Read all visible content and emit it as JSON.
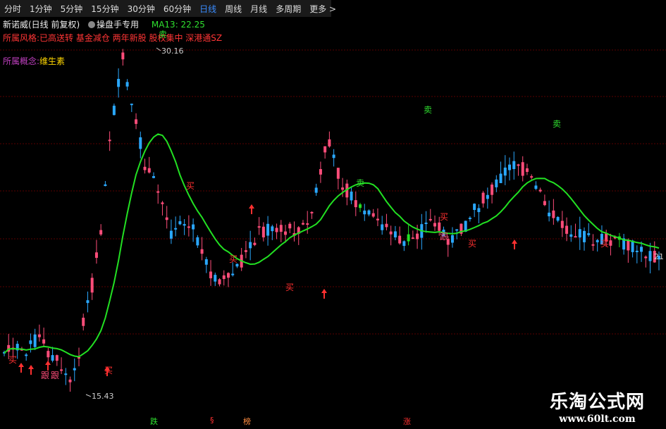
{
  "toolbar": {
    "tabs": [
      "分时",
      "1分钟",
      "5分钟",
      "15分钟",
      "30分钟",
      "60分钟",
      "日线",
      "周线",
      "月线",
      "多周期",
      "更多"
    ],
    "active": "日线"
  },
  "header": {
    "stock": "新诺威(日线 前复权)",
    "tool_button": "操盘手专用",
    "ma_label": "MA13: 22.25"
  },
  "info": {
    "style_label": "所属风格:",
    "style_value": "已高送转 基金减仓 两年新股 股权集中 深港通SZ",
    "concept_label": "所属概念:",
    "concept_value": "维生素"
  },
  "chart_data": {
    "type": "candlestick",
    "indicator": "MA13",
    "high_label": "30.16",
    "low_label": "15.43",
    "right_price_label": "21",
    "colors": {
      "up": "#ff4d7a",
      "down": "#2aa8ff",
      "ma": "#22e022",
      "grid": "#5a0000",
      "signal": "#ff3030"
    },
    "signals": [
      {
        "text": "卖",
        "color": "#2fe02f"
      },
      {
        "text": "卖",
        "color": "#2fe02f"
      },
      {
        "text": "卖",
        "color": "#2fe02f"
      },
      {
        "text": "卖",
        "color": "#2fe02f"
      },
      {
        "text": "买",
        "color": "#ff3030"
      },
      {
        "text": "买",
        "color": "#ff3030"
      },
      {
        "text": "买",
        "color": "#ff3030"
      },
      {
        "text": "买",
        "color": "#ff3030"
      },
      {
        "text": "买",
        "color": "#ff3030"
      },
      {
        "text": "买",
        "color": "#ff3030"
      },
      {
        "text": "买",
        "color": "#ff3030"
      },
      {
        "text": "买",
        "color": "#ff3030"
      },
      {
        "text": "跟",
        "color": "#ff4d7a"
      },
      {
        "text": "跟",
        "color": "#ff4d7a"
      },
      {
        "text": "跟",
        "color": "#ff4d7a"
      }
    ],
    "footer": [
      {
        "text": "跌",
        "color": "#2fe02f"
      },
      {
        "text": "§",
        "color": "#ff3030"
      },
      {
        "text": "榜",
        "color": "#ff8c40"
      },
      {
        "text": "涨",
        "color": "#ff3030"
      }
    ]
  },
  "watermark": {
    "title": "乐淘公式网",
    "url": "www.60lt.com"
  }
}
